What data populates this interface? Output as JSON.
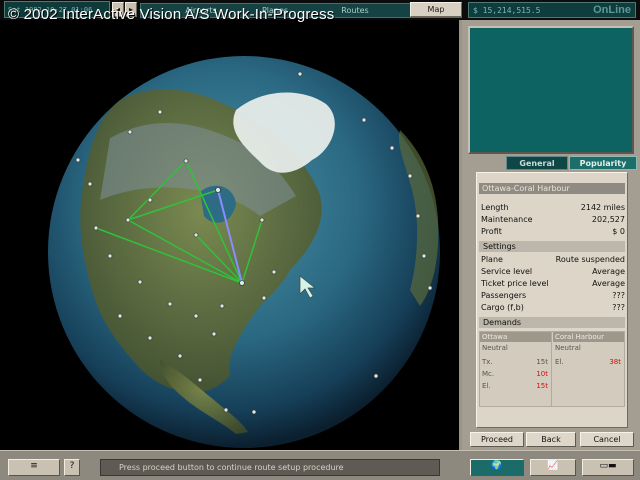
{
  "watermark": "© 2002 InterActive Vision A/S Work-In-Progress",
  "topbar": {
    "clock": "Sat 1982-10-27 01:06",
    "tabs": {
      "airports": "Airports",
      "planes": "Planes",
      "routes": "Routes",
      "map": "Map"
    },
    "money": "$ 15,214,515.5",
    "online": "OnLine"
  },
  "panel": {
    "tabs": {
      "general": "General",
      "popularity": "Popularity"
    },
    "route_title": "Ottawa-Coral Harbour",
    "stats": [
      {
        "label": "Length",
        "value": "2142 miles"
      },
      {
        "label": "Maintenance",
        "value": "202,527"
      },
      {
        "label": "Profit",
        "value": "$ 0"
      }
    ],
    "settings_header": "Settings",
    "settings": [
      {
        "label": "Plane",
        "value": "Route suspended"
      },
      {
        "label": "Service level",
        "value": "Average"
      },
      {
        "label": "Ticket price level",
        "value": "Average"
      },
      {
        "label": "Passengers",
        "value": "???"
      },
      {
        "label": "Cargo (f,b)",
        "value": "???"
      }
    ],
    "demands_header": "Demands",
    "demands": {
      "left": {
        "city": "Ottawa",
        "status": "Neutral",
        "rows": [
          {
            "label": "Tx.",
            "value": "15t"
          },
          {
            "label": "Mc.",
            "value": "10t"
          },
          {
            "label": "El.",
            "value": "15t"
          }
        ]
      },
      "right": {
        "city": "Coral Harbour",
        "status": "Neutral",
        "rows": [
          {
            "label": "El.",
            "value": "38t"
          }
        ]
      }
    },
    "buttons": {
      "proceed": "Proceed",
      "back": "Back",
      "cancel": "Cancel"
    }
  },
  "status_message": "Press proceed button to continue route setup procedure",
  "bottom": {
    "settings_icon": "≡",
    "help_icon": "?"
  },
  "colors": {
    "panel_bg": "#a39d92",
    "accent_teal": "#0f4646",
    "route_green": "#2fc23a",
    "route_selected": "#8a8cff",
    "demand_red": "#d01010"
  }
}
